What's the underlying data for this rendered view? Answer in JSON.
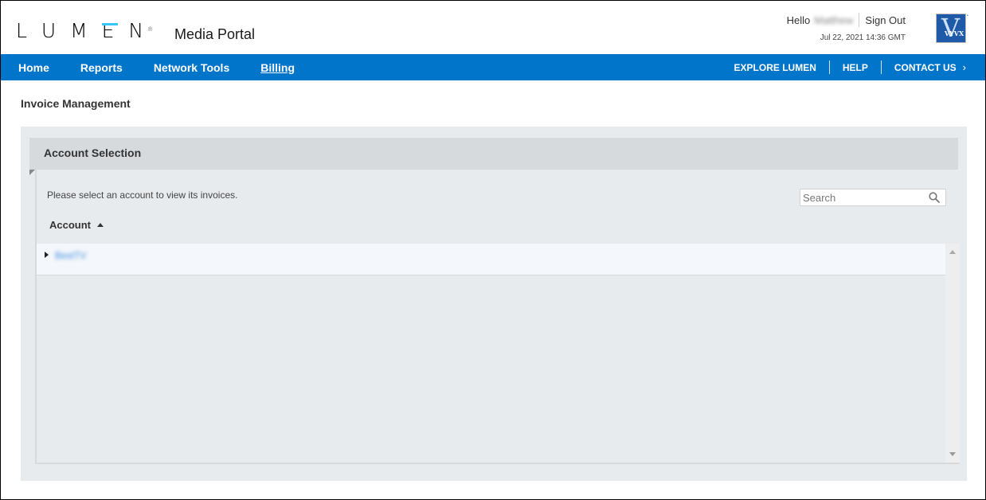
{
  "header": {
    "logo_text": "LUMEN",
    "logo_trademark": "®",
    "portal_title": "Media Portal",
    "hello_label": "Hello",
    "user_name": "Matthew",
    "sign_out_label": "Sign Out",
    "timestamp": "Jul 22, 2021 14:36 GMT",
    "partner_logo_text": "VYVX",
    "partner_logo_letter": "V"
  },
  "nav": {
    "left_items": [
      {
        "label": "Home",
        "active": false
      },
      {
        "label": "Reports",
        "active": false
      },
      {
        "label": "Network Tools",
        "active": false
      },
      {
        "label": "Billing",
        "active": true
      }
    ],
    "right_items": [
      {
        "label": "EXPLORE LUMEN"
      },
      {
        "label": "HELP"
      },
      {
        "label": "CONTACT US",
        "chevron": "›"
      }
    ]
  },
  "page": {
    "title": "Invoice Management"
  },
  "panel": {
    "title": "Account Selection",
    "instructions": "Please select an account to view its invoices.",
    "search": {
      "placeholder": "Search",
      "value": ""
    },
    "column_header": "Account",
    "sort_direction": "ascending",
    "rows": [
      {
        "account": "BestTV",
        "expanded": false
      }
    ]
  },
  "colors": {
    "brand_blue": "#0075c9",
    "accent_cyan": "#38c6f4",
    "link_blue": "#3a8de0"
  }
}
